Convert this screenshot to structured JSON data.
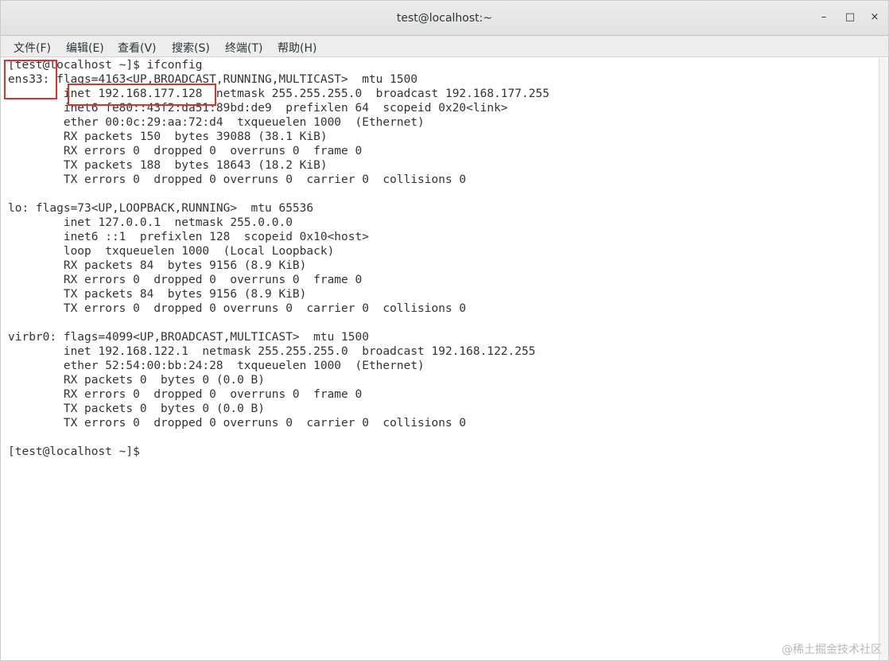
{
  "window": {
    "title": "test@localhost:~",
    "buttons": {
      "minimize": "–",
      "maximize": "□",
      "close": "×"
    }
  },
  "menu": [
    {
      "label": "文件(F)"
    },
    {
      "label": "编辑(E)"
    },
    {
      "label": "查看(V)"
    },
    {
      "label": "搜索(S)"
    },
    {
      "label": "终端(T)"
    },
    {
      "label": "帮助(H)"
    }
  ],
  "terminal": {
    "lines": [
      "[test@localhost ~]$ ifconfig",
      "ens33: flags=4163<UP,BROADCAST,RUNNING,MULTICAST>  mtu 1500",
      "        inet 192.168.177.128  netmask 255.255.255.0  broadcast 192.168.177.255",
      "        inet6 fe80::43f2:da51:89bd:de9  prefixlen 64  scopeid 0x20<link>",
      "        ether 00:0c:29:aa:72:d4  txqueuelen 1000  (Ethernet)",
      "        RX packets 150  bytes 39088 (38.1 KiB)",
      "        RX errors 0  dropped 0  overruns 0  frame 0",
      "        TX packets 188  bytes 18643 (18.2 KiB)",
      "        TX errors 0  dropped 0 overruns 0  carrier 0  collisions 0",
      "",
      "lo: flags=73<UP,LOOPBACK,RUNNING>  mtu 65536",
      "        inet 127.0.0.1  netmask 255.0.0.0",
      "        inet6 ::1  prefixlen 128  scopeid 0x10<host>",
      "        loop  txqueuelen 1000  (Local Loopback)",
      "        RX packets 84  bytes 9156 (8.9 KiB)",
      "        RX errors 0  dropped 0  overruns 0  frame 0",
      "        TX packets 84  bytes 9156 (8.9 KiB)",
      "        TX errors 0  dropped 0 overruns 0  carrier 0  collisions 0",
      "",
      "virbr0: flags=4099<UP,BROADCAST,MULTICAST>  mtu 1500",
      "        inet 192.168.122.1  netmask 255.255.255.0  broadcast 192.168.122.255",
      "        ether 52:54:00:bb:24:28  txqueuelen 1000  (Ethernet)",
      "        RX packets 0  bytes 0 (0.0 B)",
      "        RX errors 0  dropped 0  overruns 0  frame 0",
      "        TX packets 0  bytes 0 (0.0 B)",
      "        TX errors 0  dropped 0 overruns 0  carrier 0  collisions 0",
      "",
      "[test@localhost ~]$ "
    ]
  },
  "watermark": "@稀土掘金技术社区",
  "colors": {
    "highlight": "#e03131",
    "terminal_text": "#333333",
    "terminal_bg": "#ffffff"
  }
}
